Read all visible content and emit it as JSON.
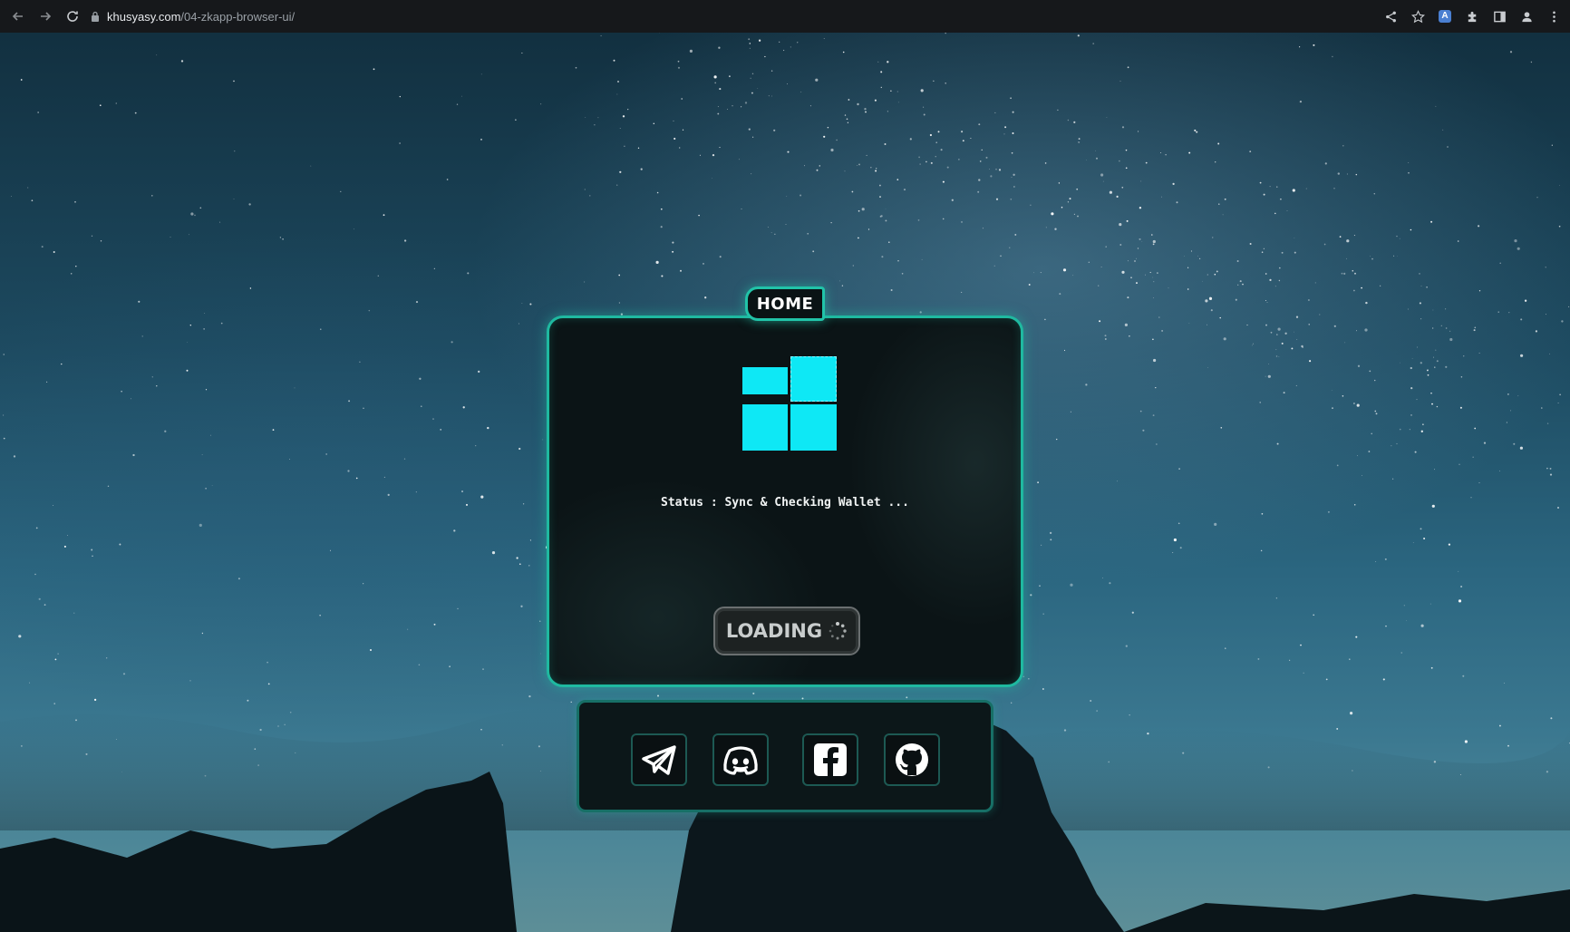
{
  "browser": {
    "url_host": "khusyasy.com",
    "url_path": "/04-zkapp-browser-ui/",
    "extension_badge": "A"
  },
  "card": {
    "tab_label": "HOME",
    "status_text": "Status : Sync & Checking Wallet ...",
    "loading_label": "LOADING",
    "accent_color": "#1fb9a0",
    "logo_color": "#0ee8f5"
  },
  "social": {
    "items": [
      {
        "icon": "telegram-icon"
      },
      {
        "icon": "discord-icon"
      },
      {
        "icon": "facebook-icon"
      },
      {
        "icon": "github-icon"
      }
    ]
  }
}
